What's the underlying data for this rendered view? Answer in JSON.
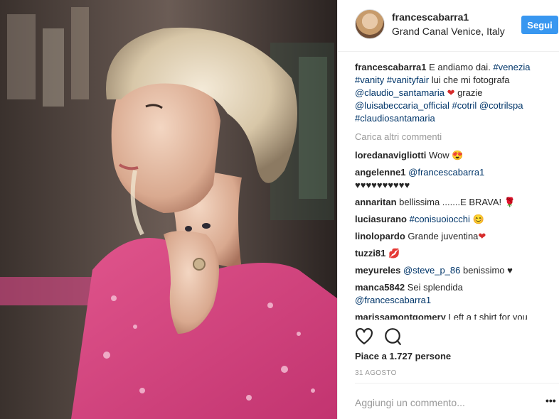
{
  "post": {
    "username": "francescabarra1",
    "location": "Grand Canal Venice, Italy",
    "follow_label": "Segui"
  },
  "caption": {
    "username": "francescabarra1",
    "text1": " E andiamo dai. ",
    "tag_venezia": "#venezia",
    "tag_vanity": "#vanity",
    "tag_vanityfair": "#vanityfair",
    "text2": " lui che mi fotografa ",
    "mention_claudio": "@claudio_santamaria",
    "text3": " grazie ",
    "mention_luisa": "@luisabeccaria_official",
    "tag_cotril": "#cotril",
    "mention_cotrilspa": "@cotrilspa",
    "tag_claudiosantamaria": "#claudiosantamaria"
  },
  "load_more": "Carica altri commenti",
  "comments": [
    {
      "user": "loredanavigliotti",
      "text": " Wow",
      "emoji": "😍"
    },
    {
      "user": "angelenne1",
      "mention": "@francescabarra1",
      "text": "♥♥♥♥♥♥♥♥♥♥"
    },
    {
      "user": "annaritan",
      "text": " bellissima .......E BRAVA!",
      "emoji": "🌹"
    },
    {
      "user": "luciasurano",
      "mention": "#conisuoiocchi",
      "emoji": "😊"
    },
    {
      "user": "linolopardo",
      "text": " Grande juventina",
      "emoji": "❤"
    },
    {
      "user": "tuzzi81",
      "emoji": "💋"
    },
    {
      "user": "meyureles",
      "mention": "@steve_p_86",
      "text": " benissimo ♥"
    },
    {
      "user": "manca5842",
      "text": " Sei splendida",
      "mention": "@francescabarra1"
    },
    {
      "user": "marissamontgomery",
      "text": " Left a t shirt for you"
    }
  ],
  "likes_text": "Piace a 1.727 persone",
  "date": "31 AGOSTO",
  "add_comment_placeholder": "Aggiungi un commento...",
  "more_options": "•••"
}
